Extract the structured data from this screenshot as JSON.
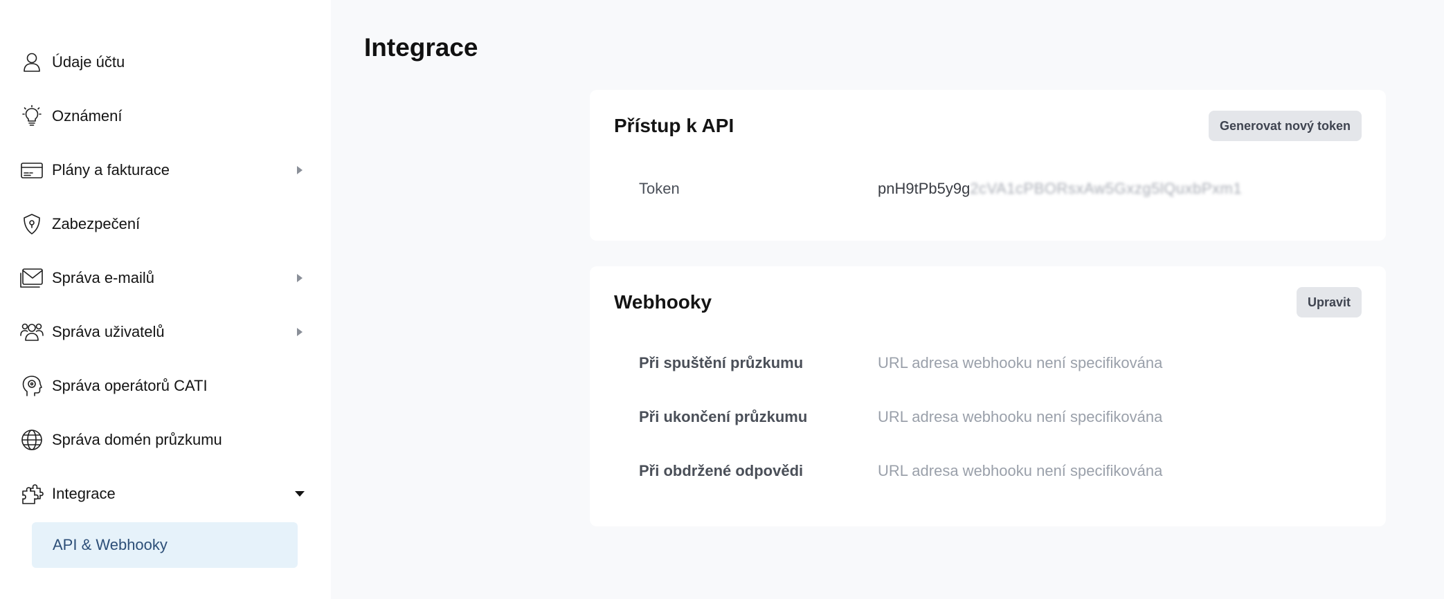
{
  "sidebar": {
    "items": [
      {
        "label": "Údaje účtu",
        "icon": "user-icon"
      },
      {
        "label": "Oznámení",
        "icon": "lightbulb-icon"
      },
      {
        "label": "Plány a fakturace",
        "icon": "credit-card-icon",
        "expandable": true
      },
      {
        "label": "Zabezpečení",
        "icon": "shield-icon"
      },
      {
        "label": "Správa e-mailů",
        "icon": "mail-icon",
        "expandable": true
      },
      {
        "label": "Správa uživatelů",
        "icon": "users-icon",
        "expandable": true
      },
      {
        "label": "Správa operátorů CATI",
        "icon": "operator-head-icon"
      },
      {
        "label": "Správa domén průzkumu",
        "icon": "globe-icon"
      },
      {
        "label": "Integrace",
        "icon": "puzzle-icon",
        "expanded": true
      }
    ],
    "sub_items": [
      {
        "label": "API & Webhooky",
        "active": true
      }
    ]
  },
  "page": {
    "title": "Integrace"
  },
  "api_card": {
    "title": "Přístup k API",
    "button_label": "Generovat nový token",
    "token_label": "Token",
    "token_visible": "pnH9tPb5y9g",
    "token_obscured": "2cVA1cPBORsxAw5Gxzg5lQuxbPxm1"
  },
  "webhooks_card": {
    "title": "Webhooky",
    "button_label": "Upravit",
    "rows": [
      {
        "label": "Při spuštění průzkumu",
        "value": "URL adresa webhooku není specifikována"
      },
      {
        "label": "Při ukončení průzkumu",
        "value": "URL adresa webhooku není specifikována"
      },
      {
        "label": "Při obdržené odpovědi",
        "value": "URL adresa webhooku není specifikována"
      }
    ]
  },
  "colors": {
    "sidebar_bg": "#ffffff",
    "main_bg": "#f8f9fb",
    "active_item_bg": "#e6f2fa",
    "active_item_text": "#2d4f78",
    "button_bg": "#e4e6ea",
    "muted_text": "#9aa0aa"
  }
}
